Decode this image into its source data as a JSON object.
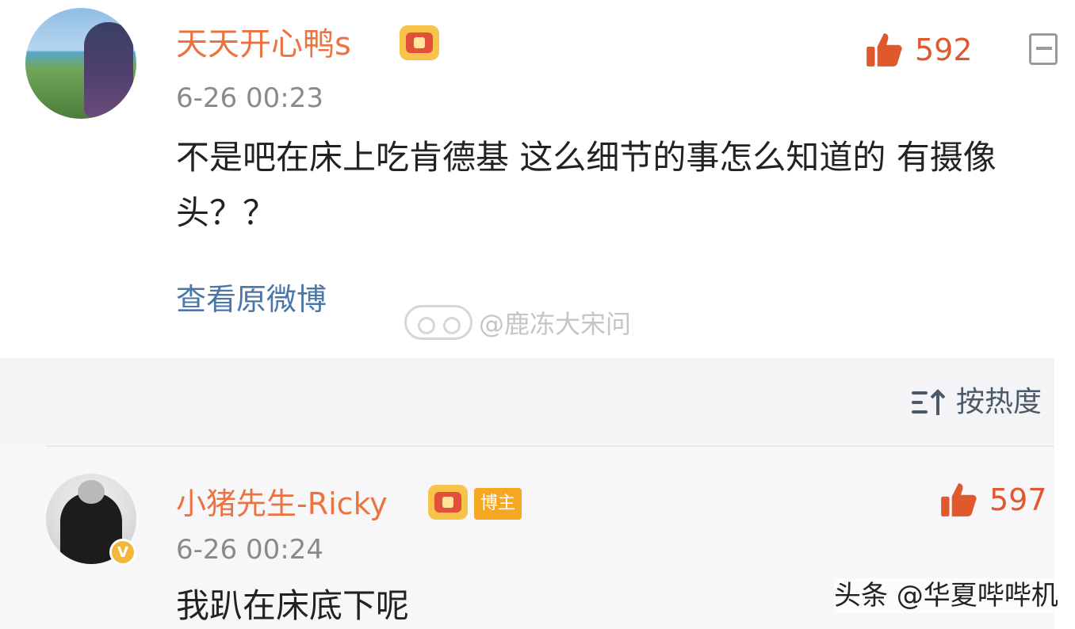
{
  "comments": [
    {
      "username": "天天开心鸭s",
      "time": "6-26 00:23",
      "content": "不是吧在床上吃肯德基 这么细节的事怎么知道的 有摄像头？？",
      "likes": "592",
      "view_original": "查看原微博"
    },
    {
      "username": "小猪先生-Ricky",
      "host_tag": "博主",
      "time": "6-26 00:24",
      "content": "我趴在床底下呢",
      "likes": "597"
    }
  ],
  "sort": {
    "label": "按热度"
  },
  "watermark": {
    "text": "@鹿冻大宋问"
  },
  "footer_watermark": "头条 @华夏哔哔机",
  "colors": {
    "username": "#eb7340",
    "like": "#e0592c",
    "link": "#4a77a8",
    "time": "#8a8a8a"
  },
  "icons": {
    "like": "thumbs-up-icon",
    "vip": "crown-vip-icon",
    "share": "share-icon",
    "sort": "sort-icon",
    "verified": "verified-v-icon"
  }
}
